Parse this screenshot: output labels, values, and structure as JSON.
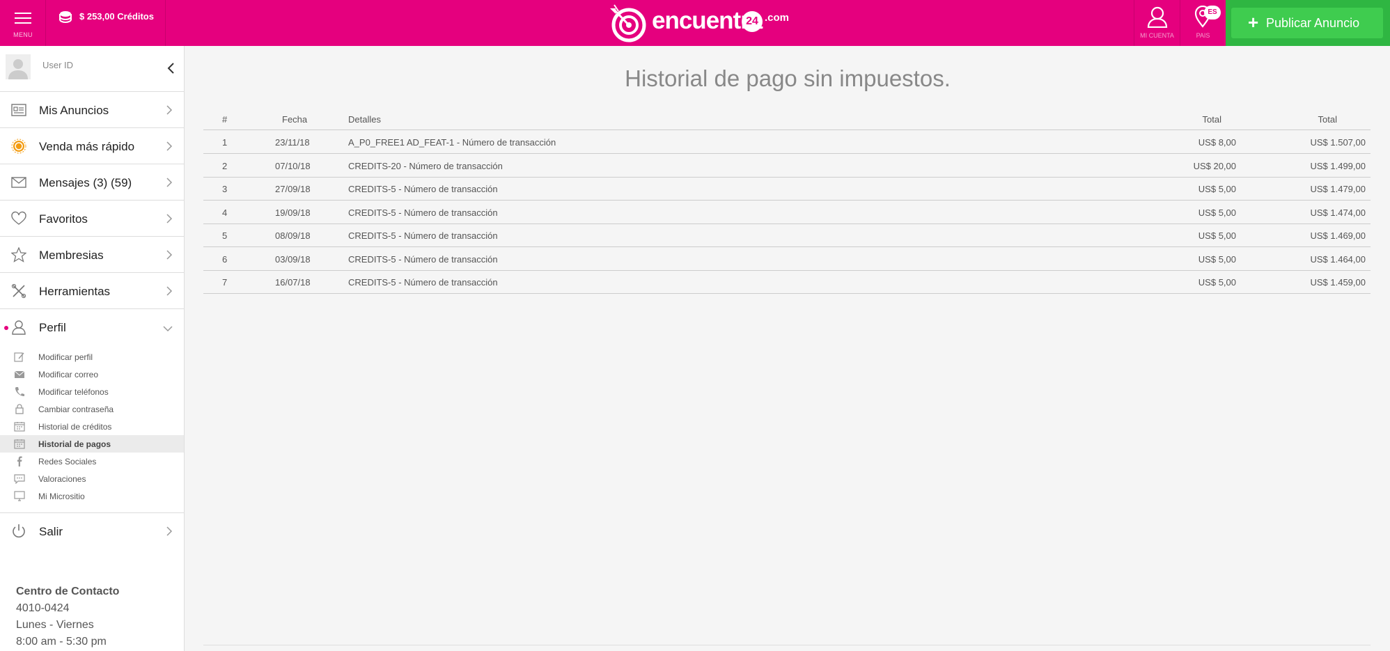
{
  "header": {
    "menu_label": "MENU",
    "credits": "$ 253,00 Créditos",
    "logo_word": "encuentra",
    "logo_number": "24",
    "logo_suffix": ".com",
    "account_label": "MI CUENTA",
    "country_label": "PAIS",
    "language_badge": "ES",
    "publish_label": "Publicar Anuncio",
    "colors": {
      "brand": "#e5007e",
      "publish": "#3fcc4f"
    }
  },
  "sidebar": {
    "user_id": "User ID",
    "nav": [
      {
        "label": "Mis Anuncios",
        "icon": "ads-list-icon"
      },
      {
        "label": "Venda más rápido",
        "icon": "boost-icon"
      },
      {
        "label": "Mensajes (3) (59)",
        "icon": "envelope-icon"
      },
      {
        "label": "Favoritos",
        "icon": "heart-icon"
      },
      {
        "label": "Membresias",
        "icon": "star-icon"
      },
      {
        "label": "Herramientas",
        "icon": "tools-icon"
      },
      {
        "label": "Perfil",
        "icon": "user-icon"
      }
    ],
    "sub": [
      {
        "label": "Modificar perfil",
        "icon": "edit-icon"
      },
      {
        "label": "Modificar correo",
        "icon": "mail-icon"
      },
      {
        "label": "Modificar teléfonos",
        "icon": "phone-icon"
      },
      {
        "label": "Cambiar contraseña",
        "icon": "lock-icon"
      },
      {
        "label": "Historial de créditos",
        "icon": "calendar-icon"
      },
      {
        "label": "Historial de pagos",
        "icon": "calendar-icon",
        "active": true
      },
      {
        "label": "Redes Sociales",
        "icon": "facebook-icon"
      },
      {
        "label": "Valoraciones",
        "icon": "comment-icon"
      },
      {
        "label": "Mi Micrositio",
        "icon": "monitor-icon"
      }
    ],
    "logout": {
      "label": "Salir",
      "icon": "power-icon"
    },
    "contact": {
      "title": "Centro de Contacto",
      "phone": "4010-0424",
      "days": "Lunes - Viernes",
      "hours": "8:00 am - 5:30 pm"
    }
  },
  "main": {
    "title": "Historial de pago sin impuestos.",
    "columns": {
      "num": "#",
      "date": "Fecha",
      "details": "Detalles",
      "total1": "Total",
      "total2": "Total"
    },
    "rows": [
      {
        "num": "1",
        "date": "23/11/18",
        "details": "A_P0_FREE1 AD_FEAT-1 - Número de transacción",
        "total1": "US$ 8,00",
        "total2": "US$ 1.507,00"
      },
      {
        "num": "2",
        "date": "07/10/18",
        "details": "CREDITS-20 - Número de transacción",
        "total1": "US$ 20,00",
        "total2": "US$ 1.499,00"
      },
      {
        "num": "3",
        "date": "27/09/18",
        "details": "CREDITS-5 - Número de transacción",
        "total1": "US$ 5,00",
        "total2": "US$ 1.479,00"
      },
      {
        "num": "4",
        "date": "19/09/18",
        "details": "CREDITS-5 - Número de transacción",
        "total1": "US$ 5,00",
        "total2": "US$ 1.474,00"
      },
      {
        "num": "5",
        "date": "08/09/18",
        "details": "CREDITS-5 - Número de transacción",
        "total1": "US$ 5,00",
        "total2": "US$ 1.469,00"
      },
      {
        "num": "6",
        "date": "03/09/18",
        "details": "CREDITS-5 - Número de transacción",
        "total1": "US$ 5,00",
        "total2": "US$ 1.464,00"
      },
      {
        "num": "7",
        "date": "16/07/18",
        "details": "CREDITS-5 - Número de transacción",
        "total1": "US$ 5,00",
        "total2": "US$ 1.459,00"
      }
    ]
  }
}
